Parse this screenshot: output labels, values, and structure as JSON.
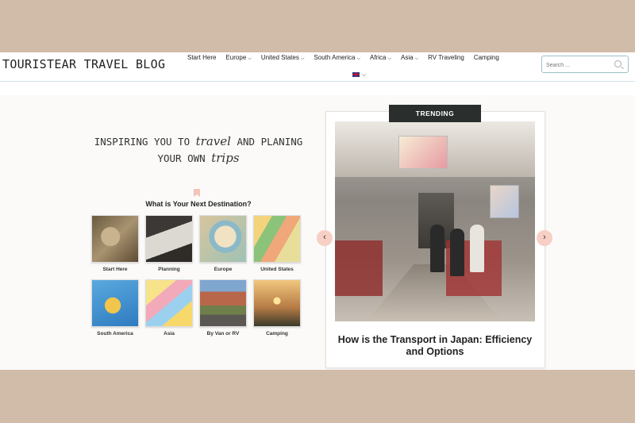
{
  "site": {
    "logo": "TOURISTEAR TRAVEL BLOG",
    "nav": [
      {
        "label": "Start Here",
        "has_dropdown": false
      },
      {
        "label": "Europe",
        "has_dropdown": true
      },
      {
        "label": "United States",
        "has_dropdown": true
      },
      {
        "label": "South America",
        "has_dropdown": true
      },
      {
        "label": "Africa",
        "has_dropdown": true
      },
      {
        "label": "Asia",
        "has_dropdown": true
      },
      {
        "label": "RV Traveling",
        "has_dropdown": false
      },
      {
        "label": "Camping",
        "has_dropdown": false
      }
    ],
    "search_placeholder": "Search ..."
  },
  "hero": {
    "tagline_1a": "INSPIRING YOU TO",
    "tagline_1b": "travel",
    "tagline_1c": "AND PLANING",
    "tagline_2a": "YOUR OWN",
    "tagline_2b": "trips",
    "destinations_title": "What is Your Next Destination?",
    "destinations": [
      {
        "label": "Start Here",
        "icon": "vintage-map-compass"
      },
      {
        "label": "Planning",
        "icon": "map-planning-desk"
      },
      {
        "label": "Europe",
        "icon": "magnifying-glass-map"
      },
      {
        "label": "United States",
        "icon": "us-map"
      },
      {
        "label": "South America",
        "icon": "south-america-map"
      },
      {
        "label": "Asia",
        "icon": "asia-map"
      },
      {
        "label": "By Van or RV",
        "icon": "road-van"
      },
      {
        "label": "Camping",
        "icon": "tent-sunset"
      }
    ]
  },
  "trending": {
    "badge": "TRENDING",
    "title": "How is the Transport in Japan: Efficiency and Options"
  },
  "colors": {
    "page_bg": "#d1bca9",
    "accent_pink": "#f7cfc4",
    "badge_bg": "#2a2e2d"
  }
}
